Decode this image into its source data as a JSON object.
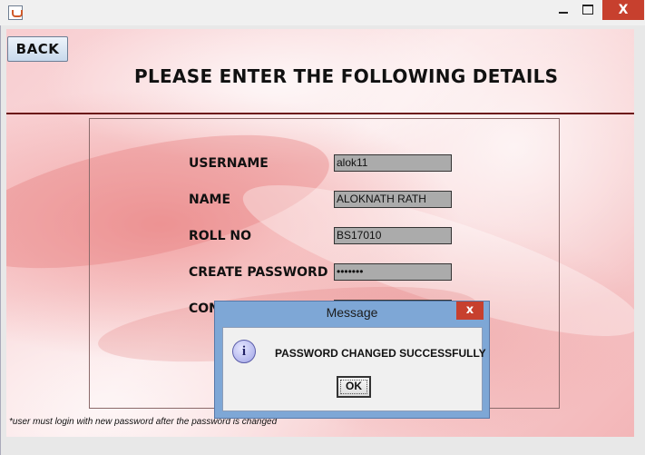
{
  "window": {
    "close_glyph": "X"
  },
  "back_button": {
    "label": "BACK"
  },
  "page_title": "PLEASE ENTER THE FOLLOWING DETAILS",
  "form": {
    "fields": [
      {
        "label": "USERNAME",
        "value": "alok11"
      },
      {
        "label": "NAME",
        "value": "ALOKNATH RATH"
      },
      {
        "label": "ROLL NO",
        "value": "BS17010"
      },
      {
        "label": "CREATE PASSWORD",
        "value": "•••••••"
      },
      {
        "label": "CON",
        "value": ""
      }
    ]
  },
  "footnote": "*user must login with new password after the password is changed",
  "dialog": {
    "title": "Message",
    "close_glyph": "x",
    "icon_glyph": "i",
    "message": "PASSWORD CHANGED SUCCESSFULLY",
    "ok_label": "OK"
  },
  "colors": {
    "accent_close": "#c7402e",
    "divider": "#6b1616",
    "dialog_frame": "#7ea7d6"
  }
}
